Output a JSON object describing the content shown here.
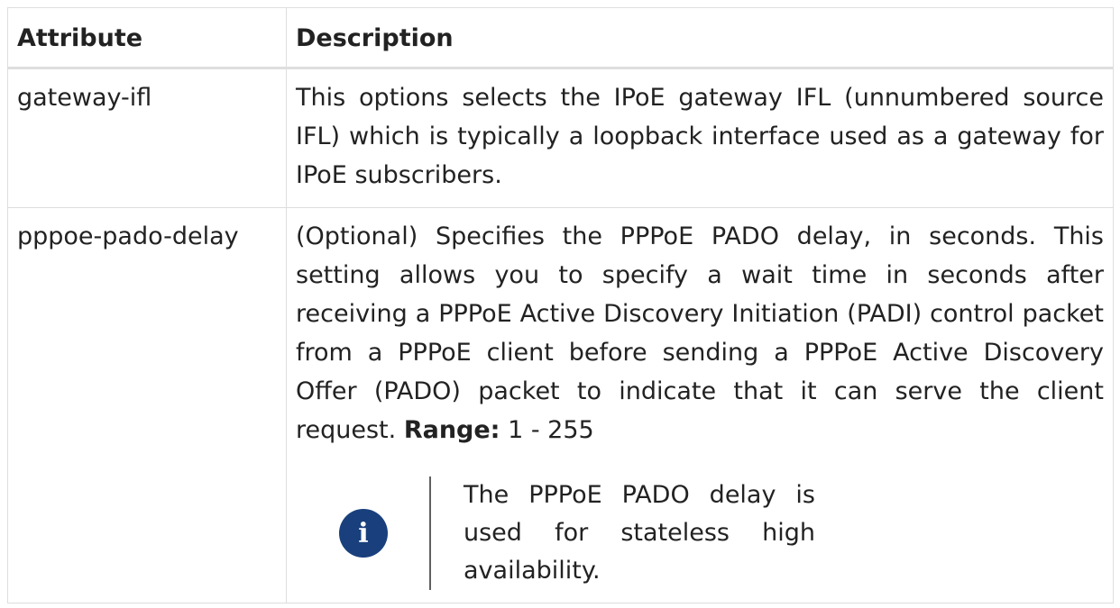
{
  "table": {
    "headers": [
      "Attribute",
      "Description"
    ],
    "rows": [
      {
        "attribute": "gateway-ifl",
        "description": "This options selects the IPoE gateway IFL (unnumbered source IFL) which is typically a loopback interface used as a gateway for IPoE subscribers."
      },
      {
        "attribute": "pppoe-pado-delay",
        "description": "(Optional) Specifies the PPPoE PADO delay, in seconds. This setting allows you to specify a wait time in seconds after receiving a PPPoE Active Discovery Initiation (PADI) control packet from a PPPoE client before sending a PPPoE Active Discovery Offer (PADO) packet to indicate that it can serve the client request.",
        "range_label": "Range:",
        "range_value": "1 - 255",
        "note": {
          "icon": "info-icon",
          "icon_glyph": "i",
          "text": "The PPPoE PADO delay is used for stateless high availability."
        }
      }
    ]
  },
  "colors": {
    "border": "#dedede",
    "text": "#222222",
    "icon_bg": "#19407c"
  }
}
